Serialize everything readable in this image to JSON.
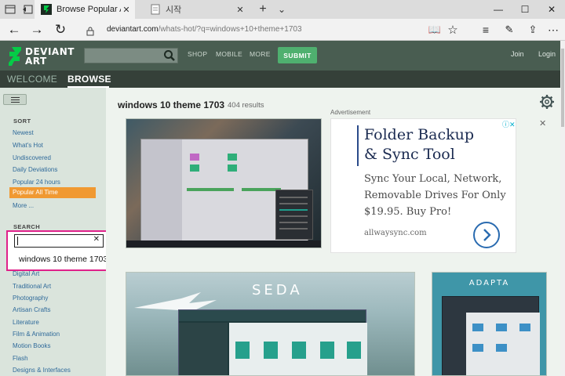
{
  "browser": {
    "active_tab_title": "Browse Popular All Time",
    "inactive_tab_title": "시작",
    "url_domain": "deviantart.com",
    "url_path": "/whats-hot/?q=windows+10+theme+1703",
    "icons": [
      "tab-list-icon",
      "tab-aside-icon",
      "back-icon",
      "forward-icon",
      "refresh-icon",
      "lock-icon",
      "reading-view-icon",
      "favorite-star-icon",
      "hub-icon",
      "notes-icon",
      "share-icon",
      "more-icon"
    ]
  },
  "site": {
    "logo_line1": "DEVIANT",
    "logo_line2": "ART",
    "nav": [
      "SHOP",
      "MOBILE",
      "MORE"
    ],
    "submit_label": "SUBMIT",
    "join_label": "Join",
    "login_label": "Login",
    "tab_welcome": "WELCOME",
    "tab_browse": "BROWSE"
  },
  "sidebar": {
    "sort_heading": "SORT",
    "sort_items": [
      "Newest",
      "What's Hot",
      "Undiscovered",
      "Daily Deviations",
      "Popular 24 hours",
      "Popular All Time",
      "More ..."
    ],
    "active_sort": "Popular All Time",
    "search_heading": "SEARCH",
    "search_value": "",
    "suggestion": "windows 10 theme 1703",
    "categories": [
      "Digital Art",
      "Traditional Art",
      "Photography",
      "Artisan Crafts",
      "Literature",
      "Film & Animation",
      "Motion Books",
      "Flash",
      "Designs & Interfaces"
    ]
  },
  "main": {
    "query_title": "windows 10 theme 1703",
    "results_count": "404 results",
    "ad_label": "Advertisement",
    "thumb2_text": "SEDA",
    "thumb3_text": "ADAPTA"
  },
  "ad": {
    "headline_1": "Folder Backup",
    "headline_2": "& Sync Tool",
    "body": "Sync Your Local, Network, Removable Drives For Only $19.95. Buy Pro!",
    "url": "allwaysync.com",
    "adchoices": "ⓘ✕",
    "close": "✕"
  },
  "colors": {
    "header": "#495d51",
    "subnav": "#354039",
    "sidebar": "#dae4dc",
    "main_bg": "#eef3ee",
    "active_sort": "#f09932",
    "submit": "#4fb06f",
    "link": "#2f6a9a",
    "highlight_box": "#e0218a"
  }
}
